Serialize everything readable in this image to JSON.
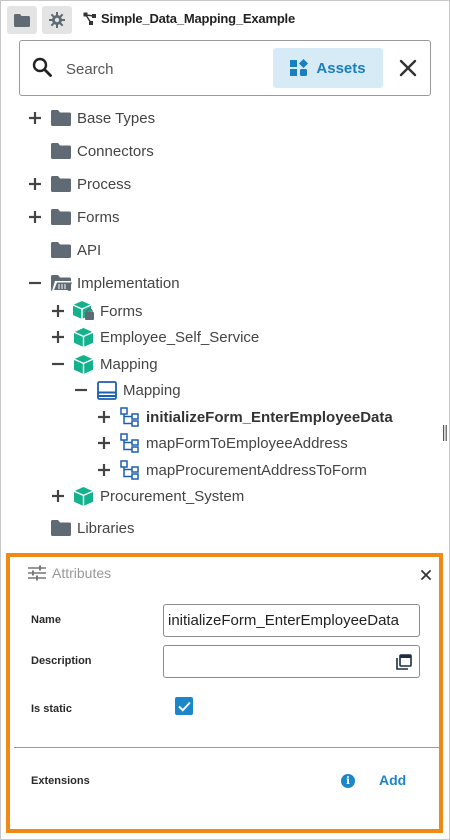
{
  "tab": {
    "title": "Simple_Data_Mapping_Example"
  },
  "search": {
    "placeholder": "Search",
    "value": "",
    "assets_label": "Assets"
  },
  "tree": {
    "base_types": "Base Types",
    "connectors": "Connectors",
    "process": "Process",
    "forms": "Forms",
    "api": "API",
    "implementation": "Implementation",
    "impl_forms": "Forms",
    "employee_self_service": "Employee_Self_Service",
    "mapping_module": "Mapping",
    "mapping_class": "Mapping",
    "op1": "initializeForm_EnterEmployeeData",
    "op2": "mapFormToEmployeeAddress",
    "op3": "mapProcurementAddressToForm",
    "procurement_system": "Procurement_System",
    "libraries": "Libraries"
  },
  "attributes": {
    "title": "Attributes",
    "name_label": "Name",
    "name_value": "initializeForm_EnterEmployeeData",
    "description_label": "Description",
    "description_value": "",
    "is_static_label": "Is static",
    "is_static": true,
    "extensions_label": "Extensions",
    "add_label": "Add"
  },
  "colors": {
    "accent": "#1b86c8",
    "panel_border": "#ef8a14",
    "module_green": "#12b28c",
    "folder_gray": "#5f6a74"
  }
}
